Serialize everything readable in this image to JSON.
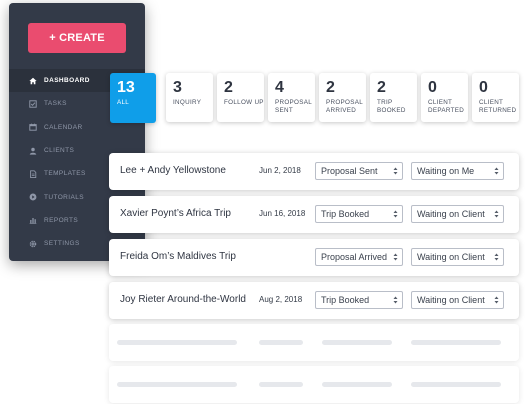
{
  "sidebar": {
    "create_label": "+ CREATE",
    "items": [
      {
        "label": "DASHBOARD",
        "icon": "home-icon",
        "active": true
      },
      {
        "label": "TASKS",
        "icon": "checkbox-icon"
      },
      {
        "label": "CALENDAR",
        "icon": "calendar-icon"
      },
      {
        "label": "CLIENTS",
        "icon": "user-icon"
      },
      {
        "label": "TEMPLATES",
        "icon": "document-icon"
      },
      {
        "label": "TUTORIALS",
        "icon": "play-icon"
      },
      {
        "label": "REPORTS",
        "icon": "bar-chart-icon"
      },
      {
        "label": "SETTINGS",
        "icon": "gear-icon"
      }
    ]
  },
  "status_cards": [
    {
      "count": "13",
      "label": "ALL",
      "active": true
    },
    {
      "count": "3",
      "label": "INQUIRY"
    },
    {
      "count": "2",
      "label": "FOLLOW UP"
    },
    {
      "count": "4",
      "label_line1": "PROPOSAL",
      "label_line2": "SENT"
    },
    {
      "count": "2",
      "label_line1": "PROPOSAL",
      "label_line2": "ARRIVED"
    },
    {
      "count": "2",
      "label_line1": "TRIP",
      "label_line2": "BOOKED"
    },
    {
      "count": "0",
      "label_line1": "CLIENT",
      "label_line2": "DEPARTED"
    },
    {
      "count": "0",
      "label_line1": "CLIENT",
      "label_line2": "RETURNED"
    }
  ],
  "trips": [
    {
      "name": "Lee + Andy Yellowstone",
      "date": "Jun 2, 2018",
      "status": "Proposal Sent",
      "waiting": "Waiting on Me"
    },
    {
      "name": "Xavier Poynt’s Africa Trip",
      "date": "Jun 16, 2018",
      "status": "Trip Booked",
      "waiting": "Waiting on Client"
    },
    {
      "name": "Freida Om’s Maldives Trip",
      "date": "",
      "status": "Proposal Arrived",
      "waiting": "Waiting on Client"
    },
    {
      "name": "Joy Rieter Around-the-World",
      "date": "Aug 2, 2018",
      "status": "Trip Booked",
      "waiting": "Waiting on Client"
    }
  ],
  "colors": {
    "sidebar_bg": "#333a48",
    "create_button": "#ea4c6f",
    "active_card": "#0f9ee9"
  }
}
